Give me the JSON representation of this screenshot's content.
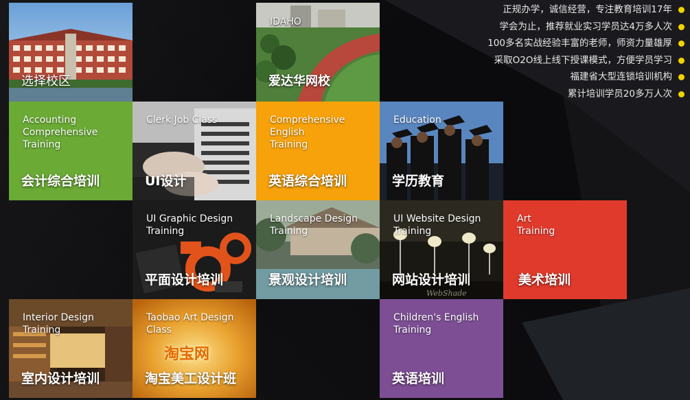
{
  "features": [
    "正规办学，诚信经营，专注教育培训17年",
    "学会为止，推荐就业实习学员达4万多人次",
    "100多名实战经验丰富的老师，师资力量雄厚",
    "采取O2O线上线下授课模式，方便学员学习",
    "福建省大型连锁培训机构",
    "累计培训学员20多万人次"
  ],
  "colors": {
    "accounting": "#6aaa35",
    "english": "#f7a20a",
    "art": "#e03a2c",
    "children": "#7d4e94",
    "bullet": "#f0d400"
  },
  "campus": {
    "label": "选择校区"
  },
  "online": {
    "sign": "IDAHO",
    "label": "爱达华网校"
  },
  "courses": {
    "accounting": {
      "en": "Accounting\nComprehensive\nTraining",
      "cn": "会计综合培训"
    },
    "clerk": {
      "en": "Clerk Job Class",
      "cn": "UI设计"
    },
    "english": {
      "en": "Comprehensive\nEnglish\nTraining",
      "cn": "英语综合培训"
    },
    "education": {
      "en": "Education",
      "cn": "学历教育"
    },
    "graphic": {
      "en": "UI Graphic Design\nTraining",
      "cn": "平面设计培训"
    },
    "landscape": {
      "en": "Landscape Design\nTraining",
      "cn": "景观设计培训"
    },
    "website": {
      "en": "UI Website Design\nTraining",
      "cn": "网站设计培训",
      "watermark": "WebShade"
    },
    "art": {
      "en": "Art\nTraining",
      "cn": "美术培训"
    },
    "interior": {
      "en": "Interior Design\nTraining",
      "cn": "室内设计培训"
    },
    "taobao": {
      "en": "Taobao Art Design\nClass",
      "cn": "淘宝美工设计班",
      "logo": "淘宝网"
    },
    "children": {
      "en": "Children's English\nTraining",
      "cn": "英语培训"
    }
  }
}
